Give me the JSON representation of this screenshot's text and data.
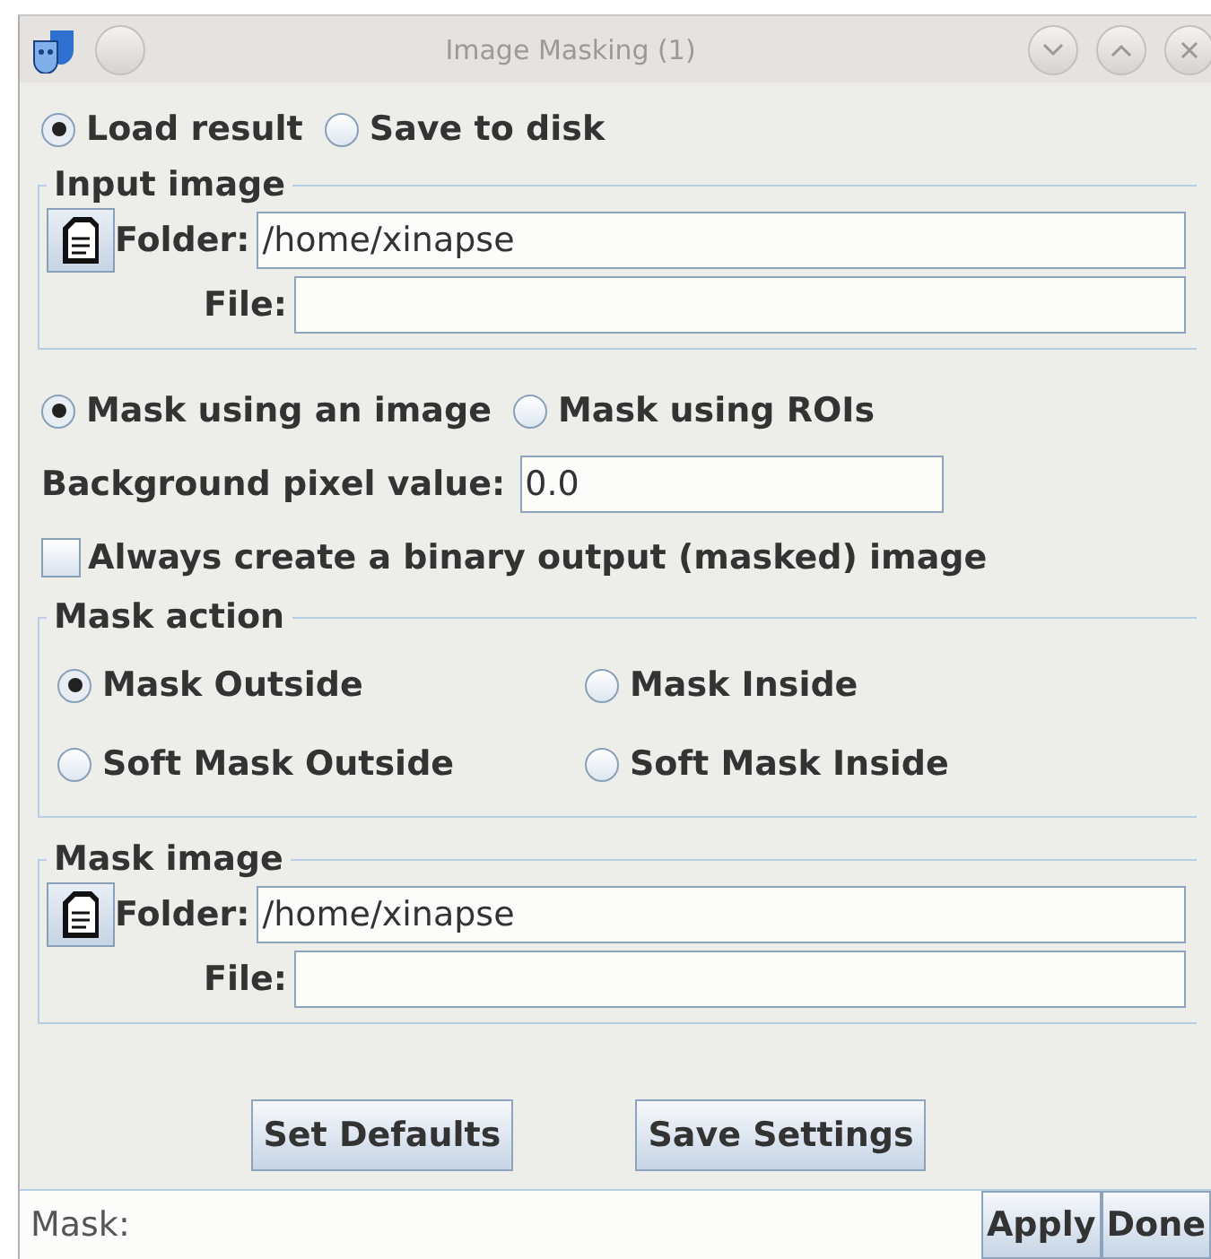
{
  "window": {
    "title": "Image Masking (1)"
  },
  "output_mode": [
    {
      "label": "Load result",
      "selected": true
    },
    {
      "label": "Save to disk",
      "selected": false
    }
  ],
  "input_image": {
    "title": "Input image",
    "folder_label": "Folder:",
    "folder": "/home/xinapse",
    "file_label": "File:"
  },
  "mask_method": [
    {
      "label": "Mask using an image",
      "selected": true
    },
    {
      "label": "Mask using ROIs",
      "selected": false
    }
  ],
  "background": {
    "label": "Background pixel value:",
    "value": "0.0"
  },
  "binary_output": {
    "label": "Always create a binary output (masked) image",
    "checked": false
  },
  "mask_action": {
    "title": "Mask action",
    "options": [
      {
        "label": "Mask Outside",
        "selected": true
      },
      {
        "label": "Mask Inside",
        "selected": false
      },
      {
        "label": "Soft Mask Outside",
        "selected": false
      },
      {
        "label": "Soft Mask Inside",
        "selected": false
      }
    ]
  },
  "mask_image": {
    "title": "Mask image",
    "folder_label": "Folder:",
    "folder": "/home/xinapse",
    "file_label": "File:"
  },
  "buttons": [
    "Set Defaults",
    "Save Settings"
  ],
  "status_bar": {
    "text": "Mask:",
    "buttons": [
      "Apply",
      "Done"
    ]
  }
}
